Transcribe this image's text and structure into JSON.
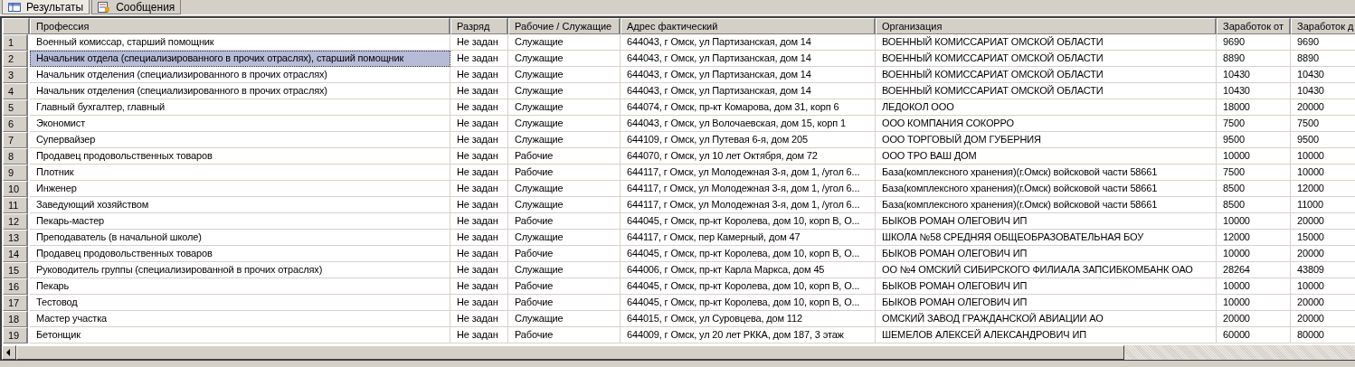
{
  "tabs": [
    {
      "label": "Результаты",
      "selected": true,
      "kind": "grid"
    },
    {
      "label": "Сообщения",
      "selected": false,
      "kind": "messages"
    }
  ],
  "table": {
    "columns": [
      "Профессия",
      "Разряд",
      "Рабочие / Служащие",
      "Адрес фактический",
      "Организация",
      "Заработок от",
      "Заработок д"
    ],
    "rows": [
      {
        "number": "1",
        "selected": false,
        "cells": [
          "Военный комиссар, старший помощник",
          "Не задан",
          "Служащие",
          "644043, г Омск, ул Партизанская, дом 14",
          "ВОЕННЫЙ КОМИССАРИАТ ОМСКОЙ ОБЛАСТИ",
          "9690",
          "9690"
        ]
      },
      {
        "number": "2",
        "selected": true,
        "cells": [
          "Начальник отдела (специализированного в прочих отраслях), старший помощник",
          "Не задан",
          "Служащие",
          "644043, г Омск, ул Партизанская, дом 14",
          "ВОЕННЫЙ КОМИССАРИАТ ОМСКОЙ ОБЛАСТИ",
          "8890",
          "8890"
        ]
      },
      {
        "number": "3",
        "selected": false,
        "cells": [
          "Начальник отделения (специализированного в прочих отраслях)",
          "Не задан",
          "Служащие",
          "644043, г Омск, ул Партизанская, дом 14",
          "ВОЕННЫЙ КОМИССАРИАТ ОМСКОЙ ОБЛАСТИ",
          "10430",
          "10430"
        ]
      },
      {
        "number": "4",
        "selected": false,
        "cells": [
          "Начальник отделения (специализированного в прочих отраслях)",
          "Не задан",
          "Служащие",
          "644043, г Омск, ул Партизанская, дом 14",
          "ВОЕННЫЙ КОМИССАРИАТ ОМСКОЙ ОБЛАСТИ",
          "10430",
          "10430"
        ]
      },
      {
        "number": "5",
        "selected": false,
        "cells": [
          "Главный бухгалтер, главный",
          "Не задан",
          "Служащие",
          "644074, г Омск, пр-кт Комарова, дом 31, корп 6",
          "ЛЕДОКОЛ ООО",
          "18000",
          "20000"
        ]
      },
      {
        "number": "6",
        "selected": false,
        "cells": [
          "Экономист",
          "Не задан",
          "Служащие",
          "644043, г Омск, ул Волочаевская, дом 15, корп 1",
          "ООО КОМПАНИЯ СОКОРРО",
          "7500",
          "7500"
        ]
      },
      {
        "number": "7",
        "selected": false,
        "cells": [
          "Супервайзер",
          "Не задан",
          "Служащие",
          "644109, г Омск, ул Путевая 6-я, дом 205",
          "ООО ТОРГОВЫЙ ДОМ ГУБЕРНИЯ",
          "9500",
          "9500"
        ]
      },
      {
        "number": "8",
        "selected": false,
        "cells": [
          "Продавец продовольственных товаров",
          "Не задан",
          "Рабочие",
          "644070, г Омск, ул 10 лет Октября, дом 72",
          "ООО ТРО ВАШ ДОМ",
          "10000",
          "10000"
        ]
      },
      {
        "number": "9",
        "selected": false,
        "cells": [
          "Плотник",
          "Не задан",
          "Рабочие",
          "644117, г Омск, ул Молодежная 3-я, дом 1, /угол 6...",
          "База(комплексного хранения)(г.Омск) войсковой части 58661",
          "7500",
          "10000"
        ]
      },
      {
        "number": "10",
        "selected": false,
        "cells": [
          "Инженер",
          "Не задан",
          "Служащие",
          "644117, г Омск, ул Молодежная 3-я, дом 1, /угол 6...",
          "База(комплексного хранения)(г.Омск) войсковой части 58661",
          "8500",
          "12000"
        ]
      },
      {
        "number": "11",
        "selected": false,
        "cells": [
          "Заведующий хозяйством",
          "Не задан",
          "Служащие",
          "644117, г Омск, ул Молодежная 3-я, дом 1, /угол 6...",
          "База(комплексного хранения)(г.Омск) войсковой части 58661",
          "8500",
          "11000"
        ]
      },
      {
        "number": "12",
        "selected": false,
        "cells": [
          "Пекарь-мастер",
          "Не задан",
          "Рабочие",
          "644045, г Омск, пр-кт Королева, дом 10, корп В, О...",
          "БЫКОВ РОМАН ОЛЕГОВИЧ ИП",
          "10000",
          "20000"
        ]
      },
      {
        "number": "13",
        "selected": false,
        "cells": [
          "Преподаватель (в начальной школе)",
          "Не задан",
          "Служащие",
          "644117, г Омск, пер Камерный, дом 47",
          "ШКОЛА №58 СРЕДНЯЯ ОБЩЕОБРАЗОВАТЕЛЬНАЯ БОУ",
          "12000",
          "15000"
        ]
      },
      {
        "number": "14",
        "selected": false,
        "cells": [
          "Продавец продовольственных товаров",
          "Не задан",
          "Рабочие",
          "644045, г Омск, пр-кт Королева, дом 10, корп В, О...",
          "БЫКОВ РОМАН ОЛЕГОВИЧ ИП",
          "10000",
          "20000"
        ]
      },
      {
        "number": "15",
        "selected": false,
        "cells": [
          "Руководитель группы (специализированной в прочих отраслях)",
          "Не задан",
          "Служащие",
          "644006, г Омск, пр-кт Карла Маркса, дом 45",
          "ОО №4 ОМСКИЙ СИБИРСКОГО ФИЛИАЛА ЗАПСИБКОМБАНК ОАО",
          "28264",
          "43809"
        ]
      },
      {
        "number": "16",
        "selected": false,
        "cells": [
          "Пекарь",
          "Не задан",
          "Рабочие",
          "644045, г Омск, пр-кт Королева, дом 10, корп В, О...",
          "БЫКОВ РОМАН ОЛЕГОВИЧ ИП",
          "10000",
          "10000"
        ]
      },
      {
        "number": "17",
        "selected": false,
        "cells": [
          "Тестовод",
          "Не задан",
          "Рабочие",
          "644045, г Омск, пр-кт Королева, дом 10, корп В, О...",
          "БЫКОВ РОМАН ОЛЕГОВИЧ ИП",
          "10000",
          "20000"
        ]
      },
      {
        "number": "18",
        "selected": false,
        "cells": [
          "Мастер участка",
          "Не задан",
          "Служащие",
          "644015, г Омск, ул Суровцева, дом 112",
          "ОМСКИЙ ЗАВОД ГРАЖДАНСКОЙ АВИАЦИИ АО",
          "20000",
          "20000"
        ]
      },
      {
        "number": "19",
        "selected": false,
        "cells": [
          "Бетонщик",
          "Не задан",
          "Рабочие",
          "644009, г Омск, ул 20 лет РККА, дом 187, 3 этаж",
          "ШЕМЕЛОВ АЛЕКСЕЙ АЛЕКСАНДРОВИЧ ИП",
          "60000",
          "80000"
        ]
      }
    ]
  }
}
